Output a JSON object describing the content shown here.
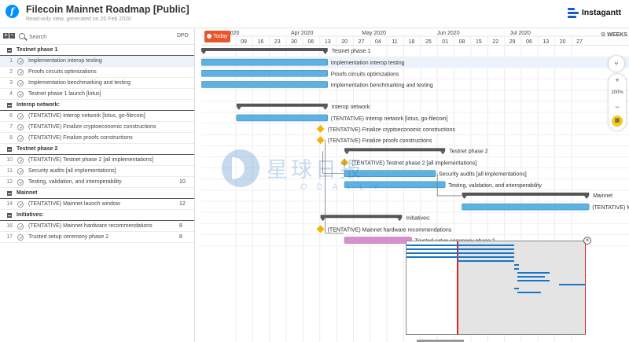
{
  "header": {
    "title": "Filecoin Mainnet Roadmap [Public]",
    "subtitle": "Read-only view, generated on 20 Feb 2020",
    "brand": "Instagantt",
    "logo_letter": "f"
  },
  "left_header": {
    "expand_all": "+",
    "collapse_all": "−",
    "search_placeholder": "Search",
    "dpd_label": "DPD"
  },
  "rows": [
    {
      "type": "group",
      "label": "Testnet phase 1"
    },
    {
      "type": "task",
      "num": "1",
      "label": "Implementation interop testing",
      "dpd": "",
      "selected": true
    },
    {
      "type": "task",
      "num": "2",
      "label": "Proofs circuits optimizations",
      "dpd": ""
    },
    {
      "type": "task",
      "num": "3",
      "label": "Implementation benchmarking and testing",
      "dpd": ""
    },
    {
      "type": "task",
      "num": "4",
      "label": "Testnet phase 1 launch [lotus]",
      "dpd": ""
    },
    {
      "type": "group",
      "label": "Interop network:"
    },
    {
      "type": "task",
      "num": "6",
      "label": "(TENTATIVE) Interop network [lotus, go-filecoin]",
      "dpd": ""
    },
    {
      "type": "task",
      "num": "7",
      "label": "(TENTATIVE) Finalize cryptoeconomic constructions",
      "dpd": ""
    },
    {
      "type": "task",
      "num": "8",
      "label": "(TENTATIVE) Finalize proofs constructions",
      "dpd": ""
    },
    {
      "type": "group",
      "label": "Testnet phase 2"
    },
    {
      "type": "task",
      "num": "10",
      "label": "(TENTATIVE) Testnet phase 2 [all implementations]",
      "dpd": ""
    },
    {
      "type": "task",
      "num": "11",
      "label": "Security audits [all implementations]",
      "dpd": ""
    },
    {
      "type": "task",
      "num": "12",
      "label": "Testing, validation, and interoperability",
      "dpd": "10"
    },
    {
      "type": "group",
      "label": "Mainnet"
    },
    {
      "type": "task",
      "num": "14",
      "label": "(TENTATIVE) Mainnet launch window",
      "dpd": "12"
    },
    {
      "type": "group",
      "label": "Initiatives:"
    },
    {
      "type": "task",
      "num": "16",
      "label": "(TENTATIVE) Mainnet hardware recommendations",
      "dpd": "8"
    },
    {
      "type": "task",
      "num": "17",
      "label": "Trusted setup ceremony phase 2",
      "dpd": "8"
    }
  ],
  "timeline": {
    "today_label": "Today",
    "weeks_label": "WEEKS",
    "months": [
      "Mar 2020",
      "Apr 2020",
      "May 2020",
      "Jun 2020",
      "Jul 2020"
    ],
    "weeks": [
      "09",
      "16",
      "23",
      "30",
      "06",
      "13",
      "20",
      "27",
      "04",
      "11",
      "18",
      "25",
      "01",
      "08",
      "15",
      "22",
      "29",
      "06",
      "13",
      "20",
      "27"
    ]
  },
  "chart_data": {
    "type": "gantt",
    "items": [
      {
        "kind": "group",
        "label": "Testnet phase 1",
        "start": "2020-02-13",
        "end": "2020-04-13"
      },
      {
        "kind": "task",
        "label": "Implementation interop testing",
        "start": "2020-02-13",
        "end": "2020-04-13"
      },
      {
        "kind": "task",
        "label": "Proofs circuits optimizations",
        "start": "2020-02-13",
        "end": "2020-04-13"
      },
      {
        "kind": "task",
        "label": "Implementation benchmarking and testing",
        "start": "2020-02-13",
        "end": "2020-04-13"
      },
      {
        "kind": "group",
        "label": "Interop network:",
        "start": "2020-03-06",
        "end": "2020-04-13"
      },
      {
        "kind": "task",
        "label": "(TENTATIVE) Interop network [lotus, go-filecoin]",
        "start": "2020-03-06",
        "end": "2020-04-13"
      },
      {
        "kind": "milestone",
        "label": "(TENTATIVE) Finalize cryptoeconomic constructions",
        "date": "2020-04-10"
      },
      {
        "kind": "milestone",
        "label": "(TENTATIVE) Finalize proofs constructions",
        "date": "2020-04-10"
      },
      {
        "kind": "group",
        "label": "Testnet phase 2",
        "start": "2020-04-20",
        "end": "2020-06-01"
      },
      {
        "kind": "milestone",
        "label": "(TENTATIVE) Testnet phase 2 [all implementations]",
        "date": "2020-04-20"
      },
      {
        "kind": "task",
        "label": "Security audits [all implementations]",
        "start": "2020-04-20",
        "end": "2020-05-28"
      },
      {
        "kind": "task",
        "label": "Testing, validation, and interoperability",
        "start": "2020-04-20",
        "end": "2020-06-01"
      },
      {
        "kind": "group",
        "label": "Mainnet",
        "start": "2020-06-08",
        "end": "2020-07-31"
      },
      {
        "kind": "task",
        "label": "(TENTATIVE) Mainnet launch window",
        "start": "2020-06-08",
        "end": "2020-07-31"
      },
      {
        "kind": "group",
        "label": "Initiatives:",
        "start": "2020-04-10",
        "end": "2020-05-14"
      },
      {
        "kind": "milestone",
        "label": "(TENTATIVE) Mainnet hardware recommendations",
        "date": "2020-04-10"
      },
      {
        "kind": "task",
        "label": "Trusted setup ceremony phase 2",
        "start": "2020-04-20",
        "end": "2020-05-18"
      }
    ]
  },
  "minimap_bars": [
    [
      0,
      0.6
    ],
    [
      0,
      0.6
    ],
    [
      0,
      0.6
    ],
    [
      0,
      0.6
    ],
    [
      0.28,
      0.6
    ],
    [
      0.6,
      0.62
    ],
    [
      0.6,
      0.62
    ],
    [
      0.62,
      0.8
    ],
    [
      0.62,
      0.77
    ],
    [
      0.62,
      0.8
    ],
    [
      0.85,
      1
    ],
    [
      0.6,
      0.62
    ],
    [
      0.62,
      0.75
    ]
  ],
  "zoom": {
    "in": "+",
    "level": "200%",
    "out": "−"
  },
  "watermark": {
    "cn": "星球日报",
    "en": "ODAILY"
  },
  "colors": {
    "bar": "#5fb2e0",
    "bar_border": "#3b90c9",
    "group": "#555555",
    "milestone": "#f5b400",
    "pink": "#d98fcc",
    "today": "#e8552a"
  }
}
